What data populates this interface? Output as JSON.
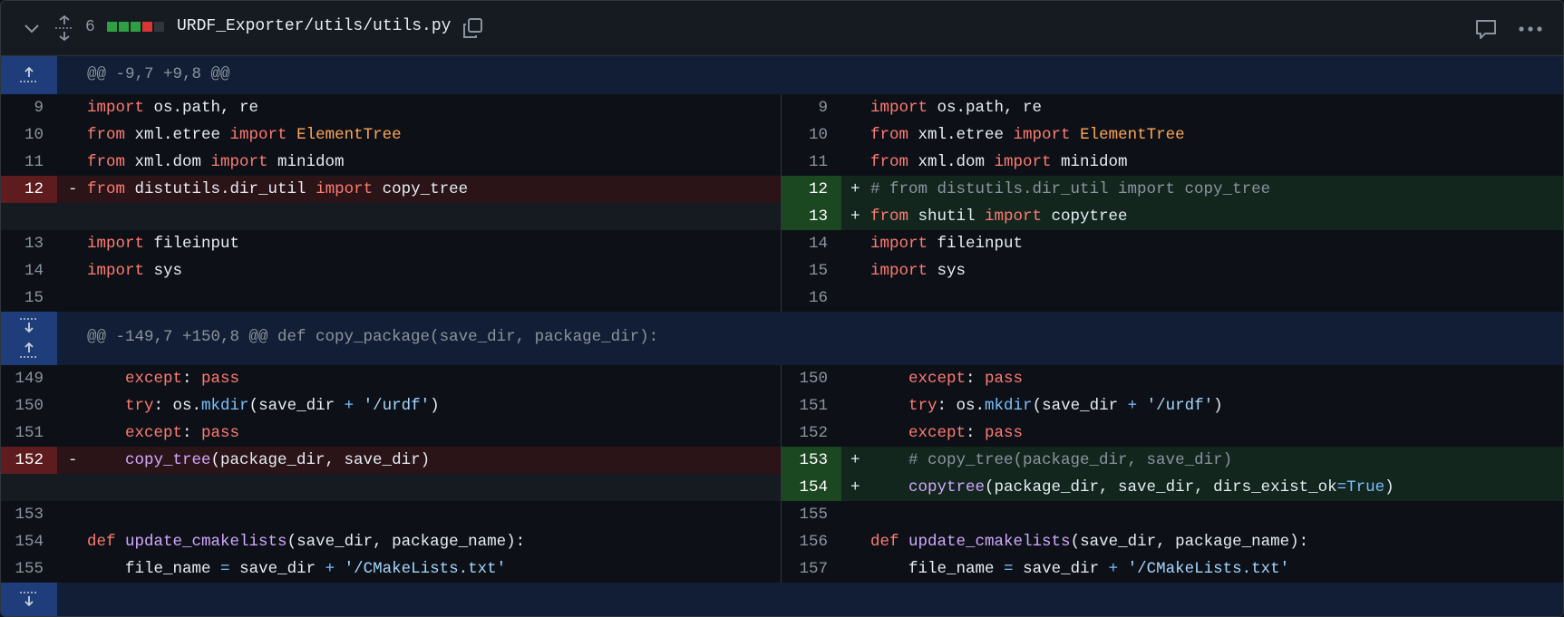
{
  "file": {
    "change_count": "6",
    "path": "URDF_Exporter/utils/utils.py",
    "diffstat": [
      "#2ea043",
      "#2ea043",
      "#2ea043",
      "#da3633",
      "#30363d"
    ]
  },
  "hunks": [
    {
      "header": "@@ -9,7 +9,8 @@"
    },
    {
      "header": "@@ -149,7 +150,8 @@ def copy_package(save_dir, package_dir):"
    }
  ],
  "icons": {
    "collapse": "chevron-down-icon",
    "expand_all": "fold-unfold-icon",
    "copy": "copy-icon",
    "comment": "comment-icon",
    "more": "kebab-horizontal-icon"
  },
  "lines": {
    "l9": "9",
    "r9": "9",
    "l10": "10",
    "r10": "10",
    "l11": "11",
    "r11": "11",
    "l12": "12",
    "r12": "12",
    "r13": "13",
    "l13": "13",
    "r14": "14",
    "l14": "14",
    "r15": "15",
    "l15": "15",
    "r16": "16",
    "l149": "149",
    "r150": "150",
    "l150": "150",
    "r151": "151",
    "l151": "151",
    "r152": "152",
    "l152": "152",
    "r153": "153",
    "r154": "154",
    "l153": "153",
    "r155": "155",
    "l154": "154",
    "r156": "156",
    "l155": "155",
    "r157": "157"
  },
  "signs": {
    "minus": "-",
    "plus": "+"
  },
  "tokens": {
    "import": "import",
    "from": "from",
    "os_path_re": " os.path, re",
    "xml_etree": " xml.etree ",
    "ElementTree": " ElementTree",
    "xml_dom": " xml.dom ",
    "minidom": " minidom",
    "distutils": " distutils.dir_util ",
    "copy_tree_sp": " copy_tree",
    "comment_from": "# from distutils.dir_util import copy_tree",
    "shutil": " shutil ",
    "copytree_sp": " copytree",
    "fileinput": " fileinput",
    "sys": " sys",
    "except": "except",
    "colon_sp": ": ",
    "pass": "pass",
    "try": "try",
    "os_dot": ": os.",
    "mkdir": "mkdir",
    "save_dir_open": "(save_dir ",
    "plus_op": "+",
    "urdf_str": " '/urdf'",
    "close": ")",
    "copy_tree": "copy_tree",
    "args_pkg": "(package_dir, save_dir)",
    "comment_copy": "# copy_tree(package_dir, save_dir)",
    "copytree": "copytree",
    "args_pkg2": "(package_dir, save_dir, dirs_exist_ok",
    "eq": "=",
    "True": "True",
    "def": "def",
    "update_cmakelists": "update_cmakelists",
    "args_update": "(save_dir, package_name):",
    "file_name": "file_name ",
    "save_dir_sp": " save_dir ",
    "cmake_str": " '/CMakeLists.txt'",
    "indent": "    "
  }
}
